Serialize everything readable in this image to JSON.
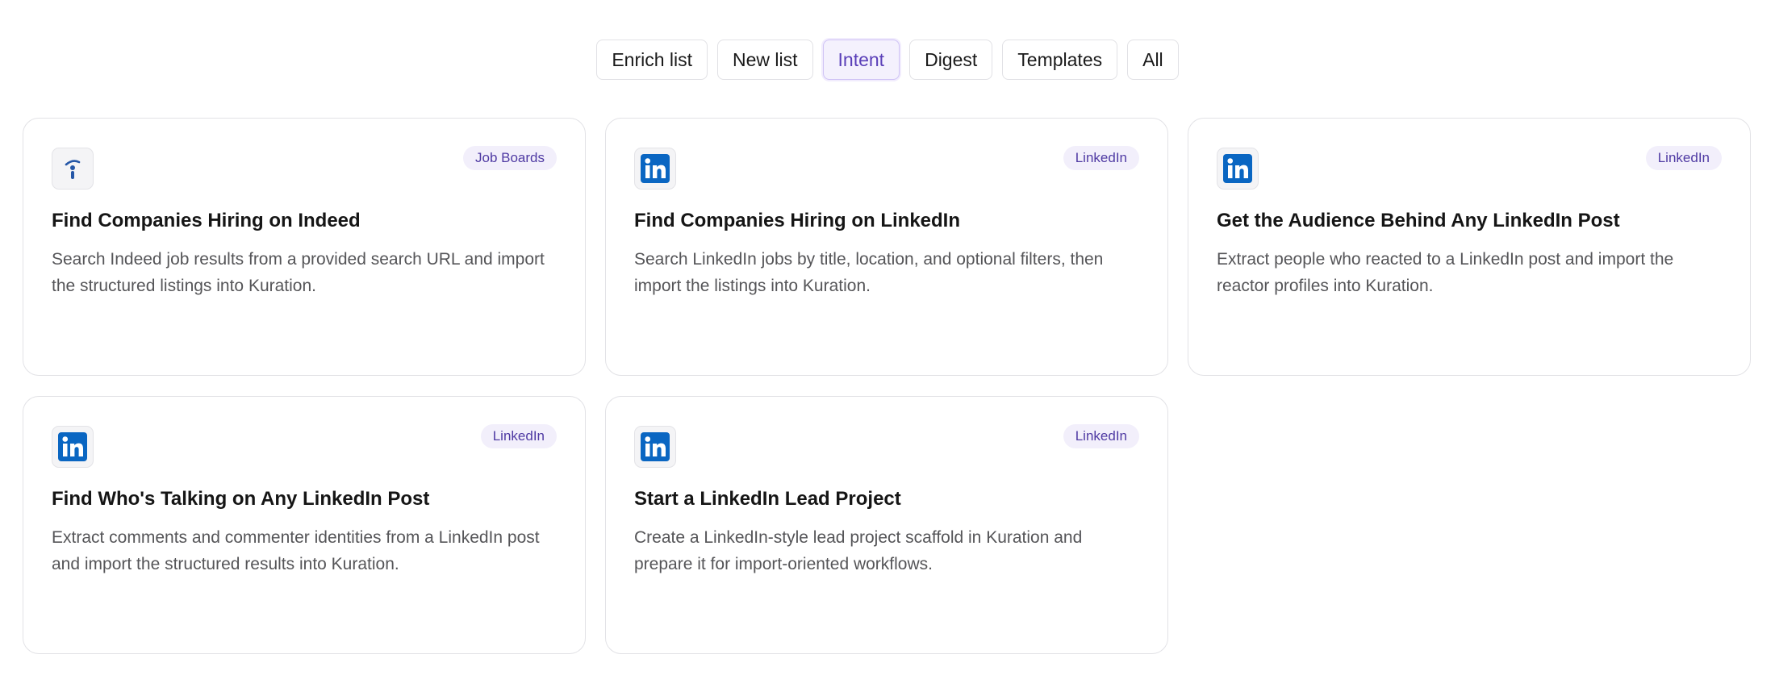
{
  "tabs": [
    {
      "label": "Enrich list",
      "active": false
    },
    {
      "label": "New list",
      "active": false
    },
    {
      "label": "Intent",
      "active": true
    },
    {
      "label": "Digest",
      "active": false
    },
    {
      "label": "Templates",
      "active": false
    },
    {
      "label": "All",
      "active": false
    }
  ],
  "colors": {
    "accent": "#5a3fb8",
    "linkedin_blue": "#0a66c2",
    "badge_bg": "#f2effb",
    "badge_text": "#4f3aa3"
  },
  "cards": [
    {
      "icon": "indeed-icon",
      "badge": "Job Boards",
      "title": "Find Companies Hiring on Indeed",
      "description": "Search Indeed job results from a provided search URL and import the structured listings into Kuration."
    },
    {
      "icon": "linkedin-icon",
      "badge": "LinkedIn",
      "title": "Find Companies Hiring on LinkedIn",
      "description": "Search LinkedIn jobs by title, location, and optional filters, then import the listings into Kuration."
    },
    {
      "icon": "linkedin-icon",
      "badge": "LinkedIn",
      "title": "Get the Audience Behind Any LinkedIn Post",
      "description": "Extract people who reacted to a LinkedIn post and import the reactor profiles into Kuration."
    },
    {
      "icon": "linkedin-icon",
      "badge": "LinkedIn",
      "title": "Find Who's Talking on Any LinkedIn Post",
      "description": "Extract comments and commenter identities from a LinkedIn post and import the structured results into Kuration."
    },
    {
      "icon": "linkedin-icon",
      "badge": "LinkedIn",
      "title": "Start a LinkedIn Lead Project",
      "description": "Create a LinkedIn-style lead project scaffold in Kuration and prepare it for import-oriented workflows."
    }
  ]
}
